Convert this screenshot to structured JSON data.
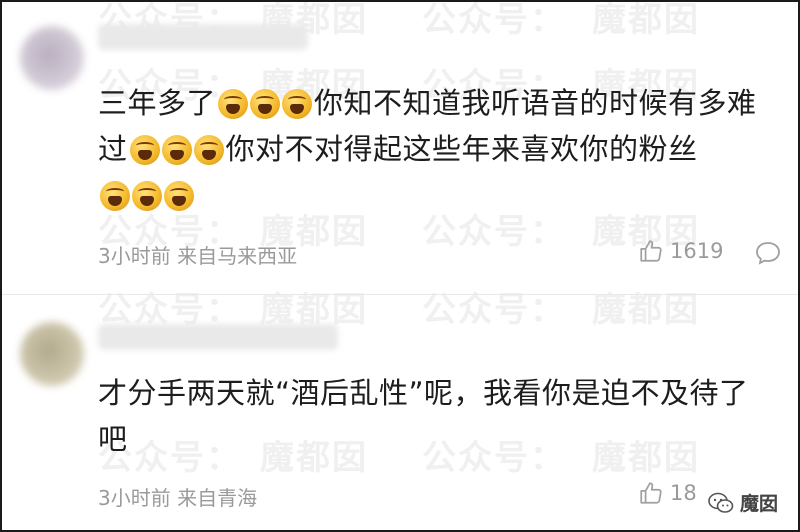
{
  "watermark": {
    "row_texts": [
      "公众号：",
      "魔都囡",
      "公众号：",
      "魔都囡",
      "公众号：",
      "魔都囡"
    ]
  },
  "comments": [
    {
      "text_parts": [
        "三年多了",
        "你知不知道我听语音的时候有多难过",
        "你对不对得起这些年来喜欢你的粉丝"
      ],
      "emoji": "angry-crying-face-emoji",
      "time": "3小时前",
      "location": "来自马来西亚",
      "likes": "1619"
    },
    {
      "text": "才分手两天就“酒后乱性”呢，我看你是迫不及待了吧",
      "time": "3小时前",
      "location": "来自青海",
      "likes": "18"
    }
  ],
  "brand": {
    "name": "魔囡",
    "icon": "wechat-logo-icon"
  }
}
